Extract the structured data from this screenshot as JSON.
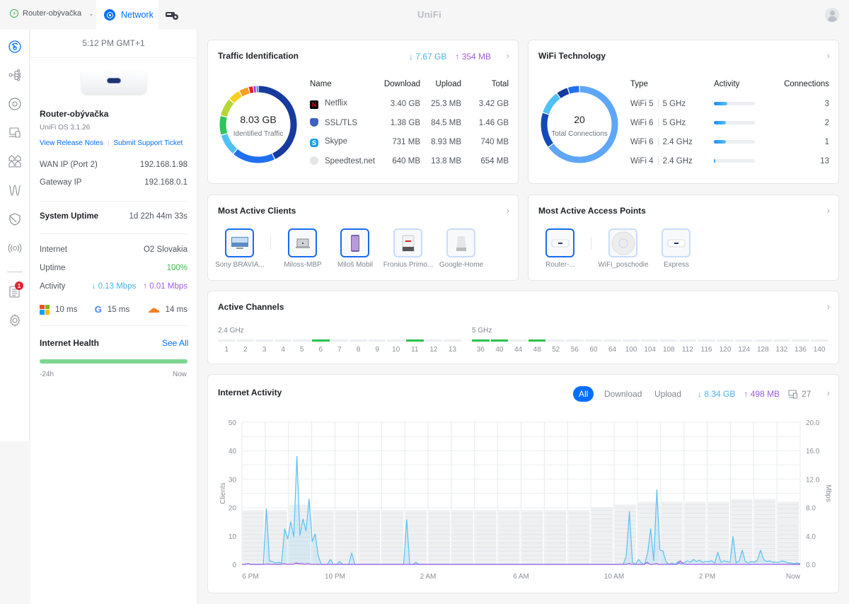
{
  "topbar": {
    "site_name": "Router-obývačka",
    "app_tab": "Network",
    "logo": "UniFi",
    "icons": [
      "site-status-icon",
      "network-app-icon",
      "protect-icon",
      "user-avatar-icon"
    ]
  },
  "nav": {
    "items": [
      "dashboard",
      "topology",
      "ubiquiti-devices",
      "client-devices",
      "ports",
      "insights",
      "security",
      "radios",
      "notifications",
      "settings"
    ],
    "notification_badge": "1"
  },
  "device": {
    "time": "5:12 PM GMT+1",
    "name": "Router-obývačka",
    "os": "UniFi OS 3.1.26",
    "release_notes": "View Release Notes",
    "support_ticket": "Submit Support Ticket",
    "wan_ip_label": "WAN IP (Port 2)",
    "wan_ip": "192.168.1.98",
    "gateway_label": "Gateway IP",
    "gateway_ip": "192.168.0.1",
    "uptime_label": "System Uptime",
    "uptime": "1d 22h 44m 33s",
    "internet_label": "Internet",
    "isp": "O2 Slovakia",
    "inet_uptime_label": "Uptime",
    "inet_uptime": "100%",
    "activity_label": "Activity",
    "activity_down": "↓ 0.13 Mbps",
    "activity_up": "↑ 0.01 Mbps",
    "latency": [
      {
        "provider": "microsoft",
        "value": "10 ms"
      },
      {
        "provider": "google",
        "value": "15 ms"
      },
      {
        "provider": "cloudflare",
        "value": "14 ms"
      }
    ],
    "health_title": "Internet Health",
    "health_see_all": "See All",
    "health_start": "-24h",
    "health_end": "Now",
    "health_uptime_pct": 100
  },
  "traffic": {
    "title": "Traffic Identification",
    "down_total": "↓ 7.67 GB",
    "up_total": "↑ 354 MB",
    "center_value": "8.03 GB",
    "center_label": "Identified Traffic",
    "headers": [
      "Name",
      "Download",
      "Upload",
      "Total"
    ],
    "rows": [
      {
        "name": "Netflix",
        "icon": "netflix-icon",
        "download": "3.40 GB",
        "upload": "25.3 MB",
        "total": "3.42 GB"
      },
      {
        "name": "SSL/TLS",
        "icon": "ssl-shield-icon",
        "download": "1.38 GB",
        "upload": "84.5 MB",
        "total": "1.46 GB"
      },
      {
        "name": "Skype",
        "icon": "skype-icon",
        "download": "731 MB",
        "upload": "8.93 MB",
        "total": "740 MB"
      },
      {
        "name": "Speedtest.net",
        "icon": "globe-icon",
        "download": "640 MB",
        "upload": "13.8 MB",
        "total": "654 MB"
      }
    ],
    "donut": [
      {
        "value": 3.42,
        "color": "#173a9e"
      },
      {
        "value": 1.46,
        "color": "#1f6ff0"
      },
      {
        "value": 0.74,
        "color": "#4fc1f5"
      },
      {
        "value": 0.65,
        "color": "#2fc45c"
      },
      {
        "value": 0.62,
        "color": "#b6d633"
      },
      {
        "value": 0.42,
        "color": "#f9d01c"
      },
      {
        "value": 0.33,
        "color": "#f3a125"
      },
      {
        "value": 0.16,
        "color": "#e51d2b"
      },
      {
        "value": 0.1,
        "color": "#9a3fe0"
      },
      {
        "value": 0.07,
        "color": "#2563eb"
      }
    ]
  },
  "wifi": {
    "title": "WiFi Technology",
    "center_value": "20",
    "center_label": "Total Connections",
    "headers": [
      "Type",
      "Activity",
      "Connections"
    ],
    "rows": [
      {
        "gen": "WiFi 5",
        "band": "5 GHz",
        "activity": 0.33,
        "connections": "3"
      },
      {
        "gen": "WiFi 6",
        "band": "5 GHz",
        "activity": 0.3,
        "connections": "2"
      },
      {
        "gen": "WiFi 6",
        "band": "2.4 GHz",
        "activity": 0.3,
        "connections": "1"
      },
      {
        "gen": "WiFi 4",
        "band": "2.4 GHz",
        "activity": 0.02,
        "connections": "13"
      }
    ],
    "donut": [
      {
        "value": 13,
        "color": "#5ea6f7"
      },
      {
        "value": 3,
        "color": "#1449b8"
      },
      {
        "value": 2,
        "color": "#4fc1f5"
      },
      {
        "value": 1,
        "color": "#173a9e"
      },
      {
        "value": 1,
        "color": "#1f6ff0"
      }
    ]
  },
  "clients": {
    "title": "Most Active Clients",
    "items": [
      {
        "name": "Sony BRAVIA...",
        "kind": "tv"
      },
      {
        "name": "Miloss-MBP",
        "kind": "laptop"
      },
      {
        "name": "Miloš Mobil",
        "kind": "phone"
      },
      {
        "name": "Fronius Primo...",
        "kind": "inverter"
      },
      {
        "name": "Google-Home",
        "kind": "speaker"
      }
    ]
  },
  "aps": {
    "title": "Most Active Access Points",
    "items": [
      {
        "name": "Router-...",
        "kind": "router"
      },
      {
        "name": "WiFi_poschodie",
        "kind": "ap-disc"
      },
      {
        "name": "Express",
        "kind": "router"
      }
    ]
  },
  "channels": {
    "title": "Active Channels",
    "band24_label": "2.4 GHz",
    "band5_label": "5 GHz",
    "band24": [
      "1",
      "2",
      "3",
      "4",
      "5",
      "6",
      "7",
      "8",
      "9",
      "10",
      "11",
      "12",
      "13"
    ],
    "band24_active": [
      "6",
      "11"
    ],
    "band5": [
      "36",
      "40",
      "44",
      "48",
      "52",
      "56",
      "60",
      "64",
      "100",
      "104",
      "108",
      "112",
      "116",
      "120",
      "124",
      "128",
      "132",
      "136",
      "140"
    ],
    "band5_active": [
      "36",
      "40",
      "48"
    ]
  },
  "activity": {
    "title": "Internet Activity",
    "filters": [
      "All",
      "Download",
      "Upload"
    ],
    "active_filter": "All",
    "down_total": "↓ 8.34 GB",
    "up_total": "↑ 498 MB",
    "clients_count": "27"
  },
  "chart_data": {
    "type": "area",
    "title": "Internet Activity",
    "xlabel": "",
    "ylabel_left": "Clients",
    "ylabel_right": "Mbps",
    "ylim_left": [
      0,
      50
    ],
    "ylim_right": [
      0,
      20
    ],
    "yticks_left": [
      "0",
      "10",
      "20",
      "30",
      "40",
      "50"
    ],
    "yticks_right": [
      "0.0",
      "4.0",
      "8.0",
      "12.0",
      "16.0",
      "20.0"
    ],
    "xticks": [
      "6 PM",
      "10 PM",
      "2 AM",
      "6 AM",
      "10 AM",
      "2 PM",
      "Now"
    ],
    "grid": true,
    "clients_per_hour": [
      19,
      19,
      21,
      19,
      19,
      19,
      19,
      19,
      19,
      19,
      19,
      19,
      19,
      19,
      19,
      20,
      21,
      22,
      22,
      22,
      22,
      23,
      23,
      22
    ],
    "series": [
      {
        "name": "Download",
        "color": "#5cc0f0",
        "values": [
          0,
          0,
          0.1,
          0,
          0,
          0,
          0,
          0,
          7.8,
          0.5,
          0.4,
          0.2,
          0.3,
          0.2,
          5.0,
          3.6,
          6.0,
          3.9,
          15.2,
          4.1,
          6.4,
          4.7,
          9.2,
          3.2,
          4.3,
          1.2,
          0,
          0,
          0,
          0.7,
          0,
          0,
          0.4,
          0,
          0,
          0,
          1.6,
          0,
          0,
          0,
          0,
          0,
          0,
          0,
          0,
          0,
          0,
          0,
          0,
          0,
          0,
          0,
          0,
          0,
          6.3,
          0,
          0,
          0.3,
          0,
          0,
          0,
          0,
          0,
          0,
          0,
          0,
          0,
          0,
          0,
          0,
          0,
          0,
          0,
          0,
          0,
          0,
          0,
          0,
          0,
          0,
          0,
          0,
          0,
          0,
          0,
          0,
          0,
          0,
          0,
          0,
          0,
          0,
          0,
          0,
          0,
          0,
          0,
          0,
          0,
          0,
          0,
          0,
          0,
          0,
          0,
          0,
          0,
          0,
          0,
          0,
          0,
          0,
          0,
          0,
          0,
          0,
          0,
          0,
          0,
          0,
          0,
          0,
          0,
          0,
          0,
          0,
          1.2,
          7.4,
          0.3,
          0,
          0.7,
          0.2,
          0,
          1.6,
          5.0,
          0.5,
          10.5,
          2.0,
          1.9,
          0.4,
          0,
          0.2,
          0,
          0.4,
          0,
          0.3,
          0.5,
          0.3,
          0.7,
          0.4,
          0.6,
          0.3,
          0.4,
          0.4,
          0.5,
          0.2,
          1.7,
          0.3,
          0.5,
          0.4,
          0.3,
          3.9,
          0.2,
          0.5,
          2.0,
          0.4,
          0.2,
          0.4,
          0.3,
          0.6,
          2.0,
          0.7,
          0.4,
          0.5,
          0.3,
          0.3,
          0.3,
          0.5,
          0.4,
          0.2,
          0.2,
          0.1,
          0.2,
          0.1
        ]
      },
      {
        "name": "Upload",
        "color": "#a15ce0",
        "values": [
          0,
          0,
          0.1,
          0,
          0,
          0,
          0,
          0,
          0.05,
          0.05,
          0,
          0,
          0,
          0,
          0.1,
          0,
          0,
          0,
          0.2,
          0.1,
          0.1,
          0,
          0.1,
          0,
          0,
          0,
          0,
          0,
          0,
          0,
          0,
          0,
          0,
          0,
          0,
          0,
          0,
          0,
          0,
          0,
          0,
          0,
          0,
          0,
          0,
          0,
          0,
          0,
          0,
          0,
          0,
          0,
          0,
          0,
          0,
          0,
          0,
          0,
          0,
          0,
          0,
          0,
          0,
          0,
          0,
          0,
          0,
          0,
          0,
          0,
          0,
          0,
          0,
          0,
          0,
          0,
          0,
          0,
          0,
          0,
          0,
          0,
          0,
          0,
          0,
          0,
          0,
          0,
          0,
          0,
          0,
          0,
          0,
          0,
          0,
          0,
          0,
          0,
          0,
          0,
          0,
          0,
          0,
          0,
          0,
          0,
          0,
          0,
          0,
          0,
          0,
          0,
          0,
          0,
          0,
          0,
          0,
          0,
          0,
          0,
          0,
          0,
          0,
          0,
          0,
          0,
          0,
          0,
          0,
          0.1,
          0,
          0,
          0,
          0,
          0,
          0.3,
          0,
          0,
          0.1,
          0,
          0,
          0,
          0,
          0,
          0,
          0,
          0.5,
          0.1,
          0,
          0,
          0,
          0,
          0,
          0,
          0,
          0,
          0,
          0,
          0,
          0,
          0,
          0,
          0,
          0,
          0,
          0,
          0,
          0,
          0,
          0,
          0,
          0,
          0,
          0,
          0,
          0,
          0,
          0,
          0,
          0,
          0,
          0,
          0,
          0,
          0,
          0,
          0
        ]
      }
    ]
  }
}
